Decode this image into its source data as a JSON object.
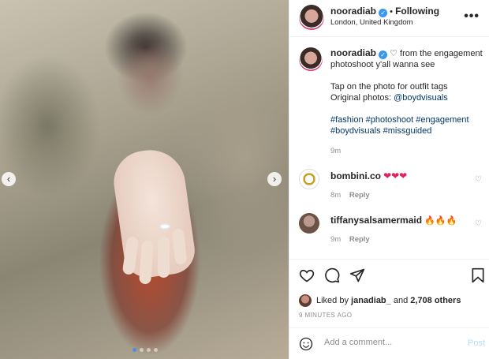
{
  "post": {
    "username": "nooradiab",
    "following_label": "Following",
    "location": "London, United Kingdom",
    "more_label": "•••"
  },
  "caption": {
    "username": "nooradiab",
    "line1": "♡ from the engagement photoshoot y'all wanna see",
    "line2": "Tap on the photo for outfit tags",
    "line3_prefix": "Original photos: ",
    "line3_link": "@boydvisuals",
    "hashtags": "#fashion #photoshoot #engagement #boydvisuals #missguided",
    "time": "9m"
  },
  "comments": [
    {
      "username": "bombini.co",
      "text": "❤❤❤",
      "time": "8m",
      "reply": "Reply"
    },
    {
      "username": "tiffanysalsamermaid",
      "text": "🔥🔥🔥",
      "time": "9m",
      "reply": "Reply"
    }
  ],
  "likes": {
    "prefix": "Liked by ",
    "user": "janadiab_",
    "middle": " and ",
    "count": "2,708 others"
  },
  "time_ago": "9 MINUTES AGO",
  "add_comment": {
    "placeholder": "Add a comment...",
    "post_label": "Post"
  },
  "carousel": {
    "count": 4,
    "active": 0
  },
  "icons": [
    "verified-badge-icon",
    "heart-icon",
    "comment-icon",
    "share-icon",
    "save-icon",
    "emoji-icon",
    "chevron-left-icon",
    "chevron-right-icon"
  ],
  "colors": {
    "accent": "#3897f0",
    "link": "#00376b",
    "muted": "#8e8e8e",
    "heart": "#e0245e"
  }
}
